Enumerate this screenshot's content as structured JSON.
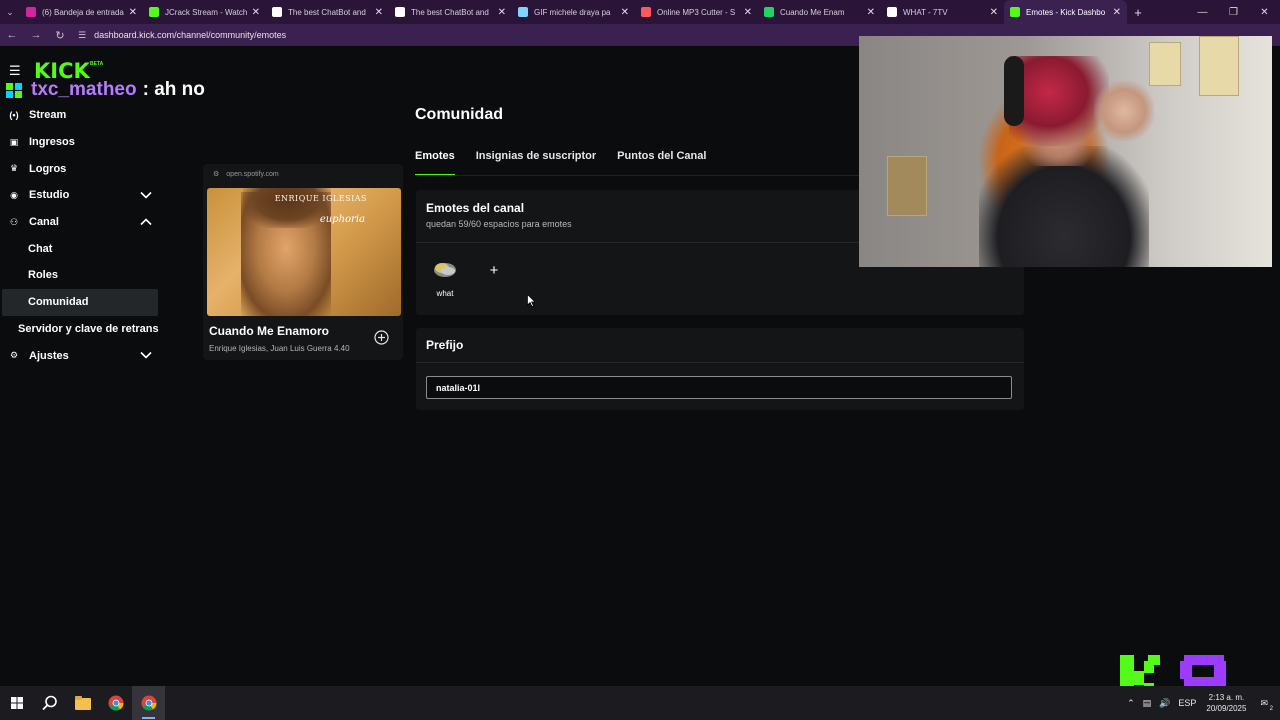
{
  "browser": {
    "tabs": [
      {
        "title": "(6) Bandeja de entrada",
        "favicon_color": "#d6249f",
        "active": false
      },
      {
        "title": "JCrack Stream - Watch",
        "favicon_color": "#53fc18",
        "active": false
      },
      {
        "title": "The best ChatBot and",
        "favicon_color": "#ffffff",
        "active": false
      },
      {
        "title": "The best ChatBot and",
        "favicon_color": "#ffffff",
        "active": false
      },
      {
        "title": "GIF michele draya pa",
        "favicon_color": "#7ed4ff",
        "active": false
      },
      {
        "title": "Online MP3 Cutter - S",
        "favicon_color": "#ff5a5a",
        "active": false
      },
      {
        "title": "Cuando Me Enam",
        "favicon_color": "#1ed760",
        "active": false
      },
      {
        "title": "WHAT - 7TV",
        "favicon_color": "#ffffff",
        "active": false
      },
      {
        "title": "Emotes - Kick Dashbo",
        "favicon_color": "#53fc18",
        "active": true
      }
    ],
    "url": "dashboard.kick.com/channel/community/emotes"
  },
  "brand": {
    "logo_text": "KICK",
    "logo_badge": "BETA",
    "accent": "#53fc18"
  },
  "chat_overlay": {
    "username": "txc_matheo",
    "message": ": ah no",
    "username_color": "#b57cff"
  },
  "sidebar": {
    "items": [
      {
        "label": "Stream",
        "icon": "broadcast-icon"
      },
      {
        "label": "Ingresos",
        "icon": "wallet-icon"
      },
      {
        "label": "Logros",
        "icon": "trophy-icon"
      },
      {
        "label": "Estudio",
        "icon": "studio-icon",
        "chevron": "down"
      },
      {
        "label": "Canal",
        "icon": "users-icon",
        "chevron": "up"
      },
      {
        "label": "Chat",
        "sub": true
      },
      {
        "label": "Roles",
        "sub": true
      },
      {
        "label": "Comunidad",
        "sub": true,
        "selected": true
      },
      {
        "label": "Servidor y clave de retrans",
        "sub": true
      },
      {
        "label": "Ajustes",
        "icon": "gear-icon",
        "chevron": "down"
      }
    ]
  },
  "spotify": {
    "source": "open.spotify.com",
    "album_artist": "ENRIQUE IGLESIAS",
    "album_name": "euphoria",
    "song": "Cuando Me Enamoro",
    "artists": "Enrique Iglesias, Juan Luis Guerra 4.40"
  },
  "main": {
    "title": "Comunidad",
    "tabs": [
      "Emotes",
      "Insignias de suscriptor",
      "Puntos del Canal"
    ],
    "emotes_panel": {
      "title": "Emotes del canal",
      "subtitle": "quedan 59/60 espacios para emotes",
      "emotes": [
        {
          "name": "what"
        }
      ],
      "add_label": "+"
    },
    "prefix_panel": {
      "title": "Prefijo",
      "value": "natalia-01l"
    }
  },
  "taskbar": {
    "tray": {
      "language": "ESP",
      "time": "2:13 a. m.",
      "date": "20/09/2025",
      "notification_count": "2"
    }
  },
  "overlay_logo": {
    "text": "K9",
    "k_color": "#53fc18",
    "nine_color": "#9b3cff"
  }
}
